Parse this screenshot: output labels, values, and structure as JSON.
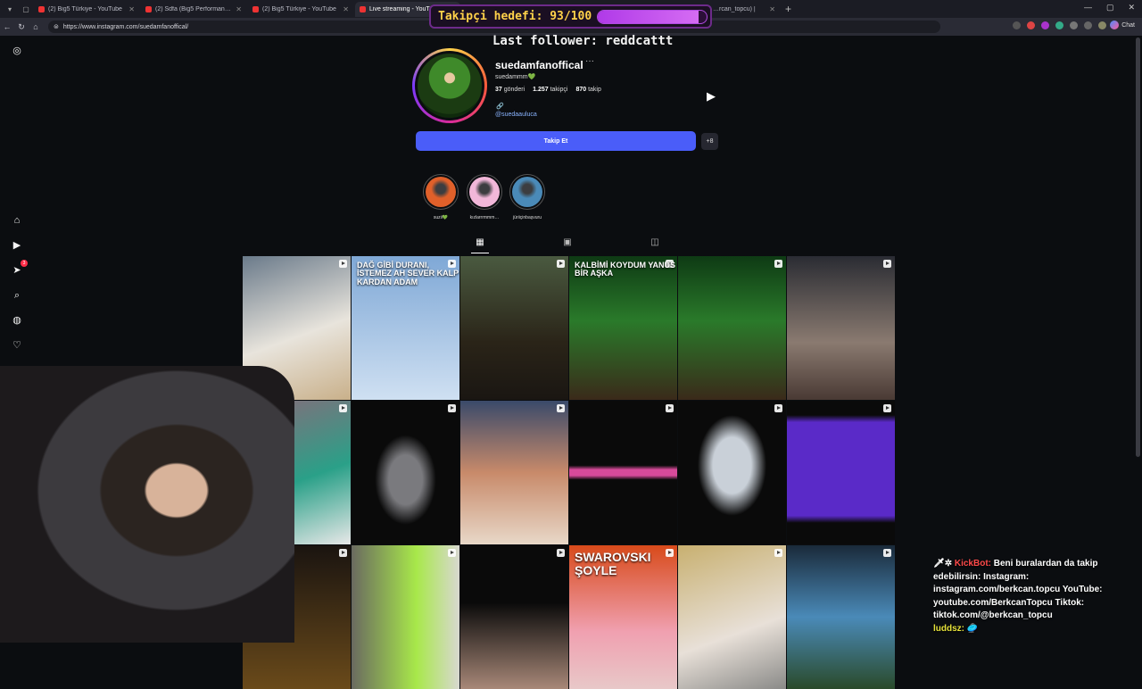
{
  "browser": {
    "tabs": [
      {
        "label": "(2) Big5 Türkiye - YouTube"
      },
      {
        "label": "(2) Sdfa (Big5 Performans) - B Gr…"
      },
      {
        "label": "(2) Big5 Türkiye - YouTube"
      },
      {
        "label": "Live streaming - YouTube"
      }
    ],
    "right_tab": "…rcan_topcu) |",
    "url": "https://www.instagram.com/suedamfanoffical/",
    "chat_label": "Chat"
  },
  "overlay": {
    "goal_text": "Takipçi hedefi: 93/100",
    "goal_progress": 0.93,
    "last_follower": "Last follower: reddcattt"
  },
  "profile": {
    "username": "suedamfanoffical",
    "more": "···",
    "full_name": "suedammm💚",
    "stats": [
      {
        "value": "37",
        "label": "gönderi"
      },
      {
        "value": "1.257",
        "label": "takipçi"
      },
      {
        "value": "870",
        "label": "takip"
      }
    ],
    "link_icon": "🔗",
    "link": "@suedaauluca",
    "follow_label": "Takip Et",
    "suggest_icon": "+8"
  },
  "highlights": [
    {
      "label": "suzii💚",
      "color": "#e0602a"
    },
    {
      "label": "kızlarrrmmm…",
      "color": "#f2b7d9"
    },
    {
      "label": "jüriiçinbaşvuru",
      "color": "#4a8ab8"
    }
  ],
  "grid_posts": [
    {
      "bg": "linear-gradient(160deg,#6a7a8a,#e8e4dc 55%,#c9b08a)",
      "cap": "",
      "big": false
    },
    {
      "bg": "linear-gradient(180deg,#7fa8d6,#cfe0f2)",
      "cap": "DAĞ GİBİ DURANI, İSTEMEZ AH SEVER KALP KARDAN ADAM",
      "big": false
    },
    {
      "bg": "linear-gradient(180deg,#4a5a40,#2a2418 60%,#1a1612)",
      "cap": "",
      "big": false
    },
    {
      "bg": "linear-gradient(180deg,#0e3a14,#2a7a2a 45%,#3a2a1a)",
      "cap": "KALBİMİ KOYDUM YANUS BİR AŞKA",
      "big": false
    },
    {
      "bg": "linear-gradient(180deg,#0e3a14,#2a7a2a 45%,#3a2a1a)",
      "cap": "",
      "big": false
    },
    {
      "bg": "linear-gradient(180deg,#2a2c33,#8a7a70 60%,#4a3a34)",
      "cap": "",
      "big": false
    },
    {
      "bg": "linear-gradient(160deg,#8a6a7a,#2aa088 55%,#e8e8e8)",
      "cap": "",
      "big": false
    },
    {
      "bg": "radial-gradient(ellipse at 50% 55%,#7a7a7e 0 22%,#0a0a0a 40%)",
      "cap": "",
      "big": false
    },
    {
      "bg": "linear-gradient(180deg,#3a4a6a,#c88a6a 50%,#e8d8c8)",
      "cap": "",
      "big": false
    },
    {
      "bg": "linear-gradient(180deg,#0a0a0a 45%,#d84a9a 48% 52%,#0a0a0a 55%)",
      "cap": "",
      "big": false
    },
    {
      "bg": "radial-gradient(ellipse at 50% 45%,#c9d0d8 0 25%,#0a0a0a 45%)",
      "cap": "",
      "big": false
    },
    {
      "bg": "linear-gradient(180deg,#0a0a0a 10%,#5a2ac8 15% 80%,#0a0a0a 85%)",
      "cap": "",
      "big": false
    },
    {
      "bg": "linear-gradient(180deg,#1a1410,#6a4a1a)",
      "cap": "",
      "big": false
    },
    {
      "bg": "linear-gradient(90deg,#6a6a60,#a8e84a 60%,#d8d8d0)",
      "cap": "",
      "big": false
    },
    {
      "bg": "linear-gradient(180deg,#0a0a0a 40%,#a88878)",
      "cap": "",
      "big": false
    },
    {
      "bg": "linear-gradient(180deg,#d84a1a,#f0a0b0 60%,#e8c8c8)",
      "cap": "SWAROVSKI ŞOYLE",
      "big": true
    },
    {
      "bg": "linear-gradient(160deg,#c8b070,#e8e0d8 60%,#8a8a88)",
      "cap": "",
      "big": false
    },
    {
      "bg": "linear-gradient(180deg,#1a2a3a,#4a8ab8 50%,#2a4a2a)",
      "cap": "",
      "big": false
    }
  ],
  "chat": {
    "line1_name": "KickBot:",
    "line1_text": "Beni buralardan da takip edebilirsin: Instagram: instagram.com/berkcan.topcu YouTube: youtube.com/BerkcanTopcu Tiktok: tiktok.com/@berkcan_topcu",
    "line2_name": "luddsz:",
    "line2_text": "🥏"
  }
}
